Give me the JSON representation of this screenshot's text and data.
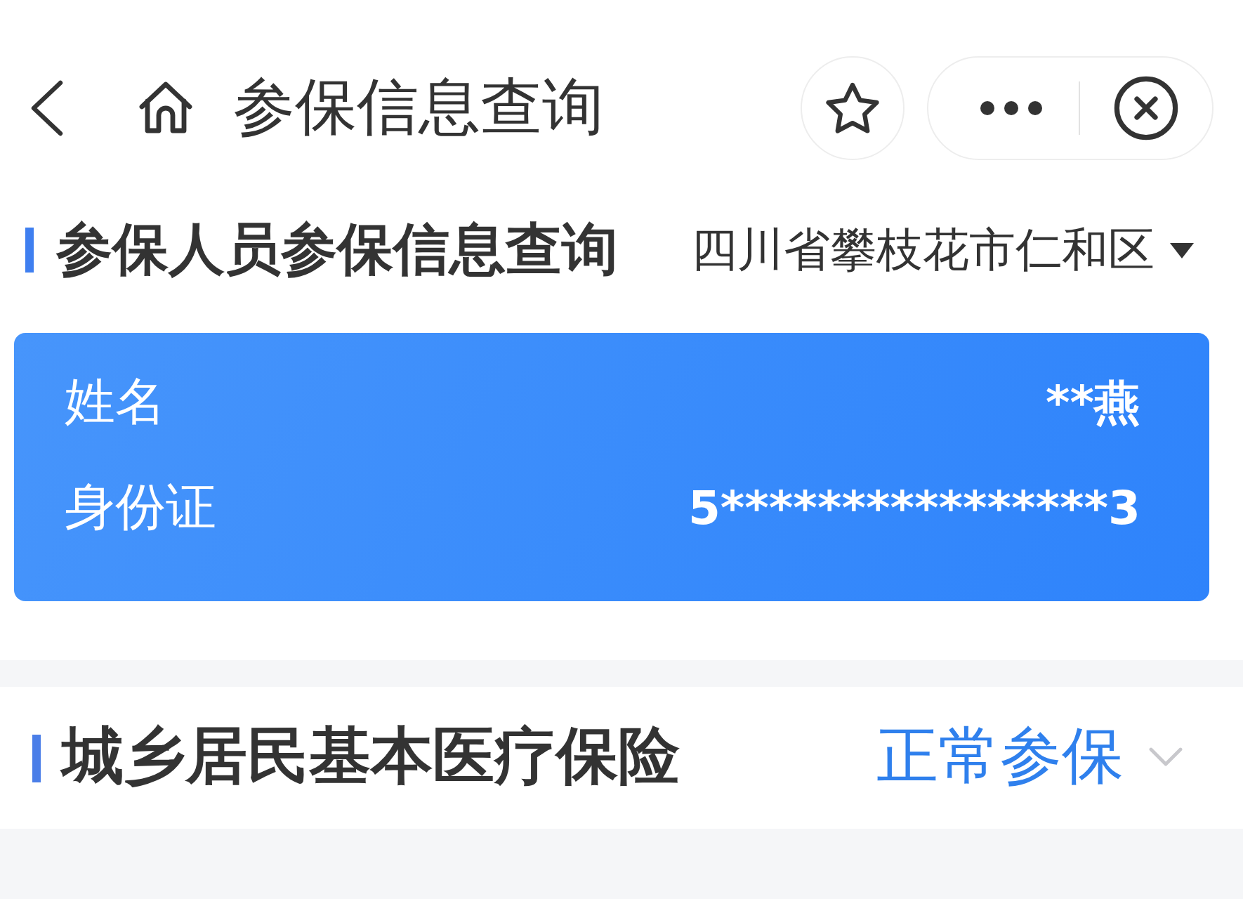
{
  "nav": {
    "title": "参保信息查询"
  },
  "section": {
    "title": "参保人员参保信息查询",
    "region": "四川省攀枝花市仁和区"
  },
  "card": {
    "rows": [
      {
        "label": "姓名",
        "value": "**燕"
      },
      {
        "label": "身份证",
        "value": "5****************3"
      }
    ]
  },
  "insurance": [
    {
      "title": "城乡居民基本医疗保险",
      "status": "正常参保",
      "expanded": false
    }
  ]
}
